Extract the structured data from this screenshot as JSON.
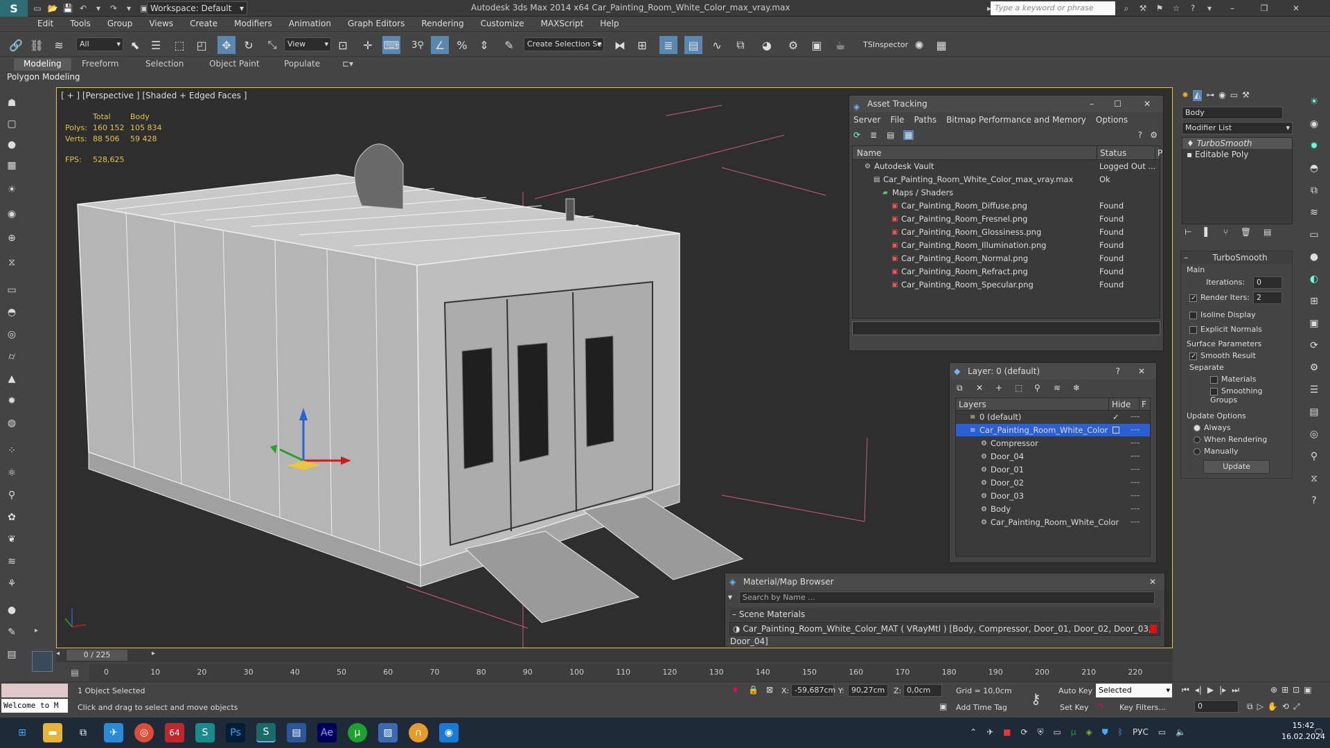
{
  "title_bar": {
    "app_title": "Autodesk 3ds Max  2014 x64     Car_Painting_Room_White_Color_max_vray.max",
    "workspace": "Workspace: Default",
    "search_placeholder": "Type a keyword or phrase"
  },
  "menu": [
    "Edit",
    "Tools",
    "Group",
    "Views",
    "Create",
    "Modifiers",
    "Animation",
    "Graph Editors",
    "Rendering",
    "Customize",
    "MAXScript",
    "Help"
  ],
  "toolbar": {
    "filter_value": "All",
    "ref_coord_value": "View",
    "selection_set_placeholder": "Create Selection Se",
    "tsinspector": "TSInspector",
    "snap_label": "3"
  },
  "ribbon_tabs": [
    "Modeling",
    "Freeform",
    "Selection",
    "Object Paint",
    "Populate"
  ],
  "ribbon_sub": "Polygon Modeling",
  "viewport": {
    "label": "[ + ] [Perspective ] [Shaded + Edged Faces ]",
    "stats": {
      "header_total": "Total",
      "header_body": "Body",
      "polys_label": "Polys:",
      "polys_total": "160 152",
      "polys_body": "105 834",
      "verts_label": "Verts:",
      "verts_total": "88 506",
      "verts_body": "59 428",
      "fps_label": "FPS:",
      "fps_value": "528,625"
    }
  },
  "asset_tracking": {
    "title": "Asset Tracking",
    "menu": [
      "Server",
      "File",
      "Paths",
      "Bitmap Performance and Memory",
      "Options"
    ],
    "col_name": "Name",
    "col_status": "Status",
    "col_p": "P",
    "rows": [
      {
        "name": "Autodesk Vault",
        "status": "Logged Out ...",
        "indent": 1,
        "icon": "vault-icon"
      },
      {
        "name": "Car_Painting_Room_White_Color_max_vray.max",
        "status": "Ok",
        "indent": 2,
        "icon": "max-file-icon"
      },
      {
        "name": "Maps / Shaders",
        "status": "",
        "indent": 3,
        "icon": "maps-folder-icon"
      },
      {
        "name": "Car_Painting_Room_Diffuse.png",
        "status": "Found",
        "indent": 4,
        "icon": "png-icon"
      },
      {
        "name": "Car_Painting_Room_Fresnel.png",
        "status": "Found",
        "indent": 4,
        "icon": "png-icon"
      },
      {
        "name": "Car_Painting_Room_Glossiness.png",
        "status": "Found",
        "indent": 4,
        "icon": "png-icon"
      },
      {
        "name": "Car_Painting_Room_Illumination.png",
        "status": "Found",
        "indent": 4,
        "icon": "png-icon"
      },
      {
        "name": "Car_Painting_Room_Normal.png",
        "status": "Found",
        "indent": 4,
        "icon": "png-icon"
      },
      {
        "name": "Car_Painting_Room_Refract.png",
        "status": "Found",
        "indent": 4,
        "icon": "png-icon"
      },
      {
        "name": "Car_Painting_Room_Specular.png",
        "status": "Found",
        "indent": 4,
        "icon": "png-icon"
      }
    ]
  },
  "layer_panel": {
    "title": "Layer: 0 (default)",
    "help": "?",
    "col_layers": "Layers",
    "col_hide": "Hide",
    "col_f": "F",
    "rows": [
      {
        "name": "0 (default)",
        "indent": 1,
        "selected": false
      },
      {
        "name": "Car_Painting_Room_White_Color",
        "indent": 1,
        "selected": true
      },
      {
        "name": "Compressor",
        "indent": 2,
        "selected": false
      },
      {
        "name": "Door_04",
        "indent": 2,
        "selected": false
      },
      {
        "name": "Door_01",
        "indent": 2,
        "selected": false
      },
      {
        "name": "Door_02",
        "indent": 2,
        "selected": false
      },
      {
        "name": "Door_03",
        "indent": 2,
        "selected": false
      },
      {
        "name": "Body",
        "indent": 2,
        "selected": false
      },
      {
        "name": "Car_Painting_Room_White_Color",
        "indent": 2,
        "selected": false
      }
    ]
  },
  "material_browser": {
    "title": "Material/Map Browser",
    "search_placeholder": "Search by Name ...",
    "section": "Scene Materials",
    "material": "Car_Painting_Room_White_Color_MAT ( VRayMtl ) [Body, Compressor, Door_01, Door_02, Door_03, Door_04]"
  },
  "command_panel": {
    "object_name": "Body",
    "modifier_list": "Modifier List",
    "stack": [
      "TurboSmooth",
      "Editable Poly"
    ],
    "rollout_title": "TurboSmooth",
    "main_label": "Main",
    "iterations_label": "Iterations:",
    "iterations_value": "0",
    "render_iters_label": "Render Iters:",
    "render_iters_value": "2",
    "isoline": "Isoline Display",
    "explicit_normals": "Explicit Normals",
    "surface_params": "Surface Parameters",
    "smooth_result": "Smooth Result",
    "separate": "Separate",
    "materials": "Materials",
    "smoothing_groups": "Smoothing Groups",
    "update_options": "Update Options",
    "always": "Always",
    "when_rendering": "When Rendering",
    "manually": "Manually",
    "update_button": "Update"
  },
  "timeline": {
    "frame_display": "0 / 225",
    "ticks": [
      "0",
      "10",
      "20",
      "30",
      "40",
      "50",
      "60",
      "70",
      "80",
      "90",
      "100",
      "110",
      "120",
      "130",
      "140",
      "150",
      "160",
      "170",
      "180",
      "190",
      "200",
      "210",
      "220"
    ]
  },
  "status": {
    "welcome": "Welcome to M",
    "selected": "1 Object Selected",
    "prompt": "Click and drag to select and move objects",
    "x_label": "X:",
    "x_value": "-59,687cm",
    "y_label": "Y:",
    "y_value": "90,27cm",
    "z_label": "Z:",
    "z_value": "0,0cm",
    "grid": "Grid = 10,0cm",
    "add_time_tag": "Add Time Tag",
    "auto_key": "Auto Key",
    "set_key": "Set Key",
    "selected_dropdown": "Selected",
    "key_filters": "Key Filters...",
    "frame_value": "0"
  },
  "taskbar": {
    "lang": "РУС",
    "time": "15:42",
    "date": "16.02.2024",
    "badge": "64"
  }
}
